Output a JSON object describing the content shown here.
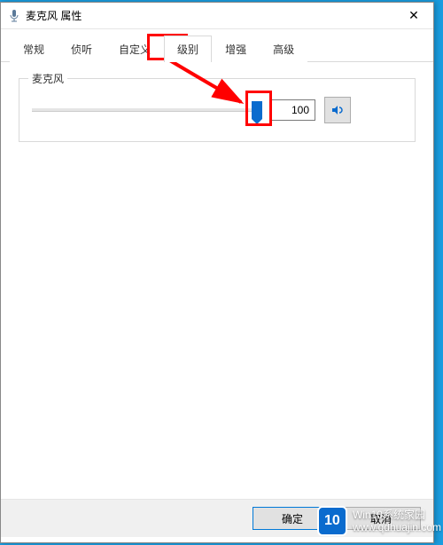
{
  "window": {
    "title": "麦克风 属性",
    "close_glyph": "✕"
  },
  "tabs": [
    {
      "label": "常规",
      "active": false
    },
    {
      "label": "侦听",
      "active": false
    },
    {
      "label": "自定义",
      "active": false
    },
    {
      "label": "级别",
      "active": true
    },
    {
      "label": "增强",
      "active": false
    },
    {
      "label": "高级",
      "active": false
    }
  ],
  "level": {
    "group_label": "麦克风",
    "value": "100",
    "slider_percent": 100,
    "speaker_icon": "volume-icon"
  },
  "buttons": {
    "ok": "确定",
    "cancel": "取消"
  },
  "watermark": {
    "line1": "Win10系统家园",
    "line2": "www.qdhuajin.com",
    "logo_text": "10"
  }
}
